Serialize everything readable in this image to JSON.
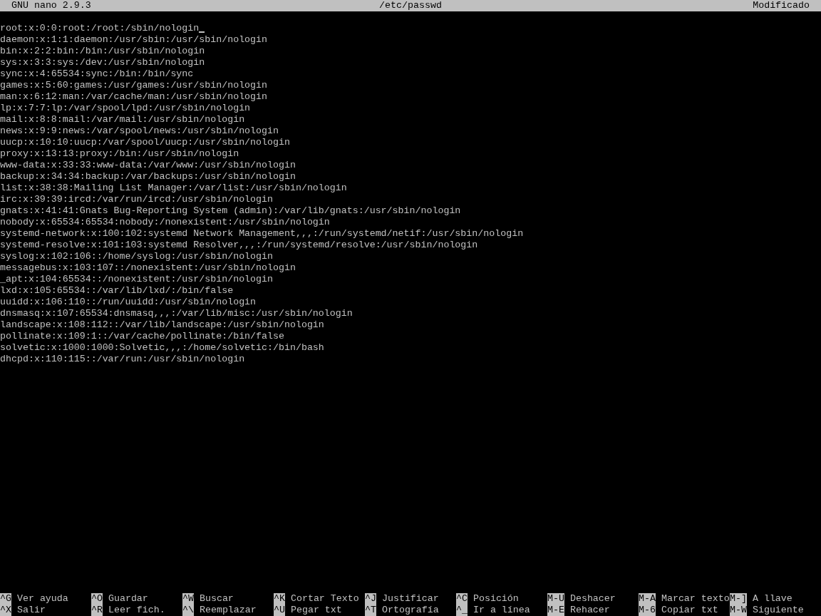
{
  "title_bar": {
    "version": "GNU nano 2.9.3",
    "filename": "/etc/passwd",
    "status": "Modificado"
  },
  "lines": [
    {
      "text": "root:x:0:0:root:/root:/sbin/nologin",
      "cursor": true
    },
    {
      "text": "daemon:x:1:1:daemon:/usr/sbin:/usr/sbin/nologin",
      "cursor": false
    },
    {
      "text": "bin:x:2:2:bin:/bin:/usr/sbin/nologin",
      "cursor": false
    },
    {
      "text": "sys:x:3:3:sys:/dev:/usr/sbin/nologin",
      "cursor": false
    },
    {
      "text": "sync:x:4:65534:sync:/bin:/bin/sync",
      "cursor": false
    },
    {
      "text": "games:x:5:60:games:/usr/games:/usr/sbin/nologin",
      "cursor": false
    },
    {
      "text": "man:x:6:12:man:/var/cache/man:/usr/sbin/nologin",
      "cursor": false
    },
    {
      "text": "lp:x:7:7:lp:/var/spool/lpd:/usr/sbin/nologin",
      "cursor": false
    },
    {
      "text": "mail:x:8:8:mail:/var/mail:/usr/sbin/nologin",
      "cursor": false
    },
    {
      "text": "news:x:9:9:news:/var/spool/news:/usr/sbin/nologin",
      "cursor": false
    },
    {
      "text": "uucp:x:10:10:uucp:/var/spool/uucp:/usr/sbin/nologin",
      "cursor": false
    },
    {
      "text": "proxy:x:13:13:proxy:/bin:/usr/sbin/nologin",
      "cursor": false
    },
    {
      "text": "www-data:x:33:33:www-data:/var/www:/usr/sbin/nologin",
      "cursor": false
    },
    {
      "text": "backup:x:34:34:backup:/var/backups:/usr/sbin/nologin",
      "cursor": false
    },
    {
      "text": "list:x:38:38:Mailing List Manager:/var/list:/usr/sbin/nologin",
      "cursor": false
    },
    {
      "text": "irc:x:39:39:ircd:/var/run/ircd:/usr/sbin/nologin",
      "cursor": false
    },
    {
      "text": "gnats:x:41:41:Gnats Bug-Reporting System (admin):/var/lib/gnats:/usr/sbin/nologin",
      "cursor": false
    },
    {
      "text": "nobody:x:65534:65534:nobody:/nonexistent:/usr/sbin/nologin",
      "cursor": false
    },
    {
      "text": "systemd-network:x:100:102:systemd Network Management,,,:/run/systemd/netif:/usr/sbin/nologin",
      "cursor": false
    },
    {
      "text": "systemd-resolve:x:101:103:systemd Resolver,,,:/run/systemd/resolve:/usr/sbin/nologin",
      "cursor": false
    },
    {
      "text": "syslog:x:102:106::/home/syslog:/usr/sbin/nologin",
      "cursor": false
    },
    {
      "text": "messagebus:x:103:107::/nonexistent:/usr/sbin/nologin",
      "cursor": false
    },
    {
      "text": "_apt:x:104:65534::/nonexistent:/usr/sbin/nologin",
      "cursor": false
    },
    {
      "text": "lxd:x:105:65534::/var/lib/lxd/:/bin/false",
      "cursor": false
    },
    {
      "text": "uuidd:x:106:110::/run/uuidd:/usr/sbin/nologin",
      "cursor": false
    },
    {
      "text": "dnsmasq:x:107:65534:dnsmasq,,,:/var/lib/misc:/usr/sbin/nologin",
      "cursor": false
    },
    {
      "text": "landscape:x:108:112::/var/lib/landscape:/usr/sbin/nologin",
      "cursor": false
    },
    {
      "text": "pollinate:x:109:1::/var/cache/pollinate:/bin/false",
      "cursor": false
    },
    {
      "text": "solvetic:x:1000:1000:Solvetic,,,:/home/solvetic:/bin/bash",
      "cursor": false
    },
    {
      "text": "dhcpd:x:110:115::/var/run:/usr/sbin/nologin",
      "cursor": false
    }
  ],
  "shortcuts": [
    {
      "key": "^G",
      "label": "Ver ayuda"
    },
    {
      "key": "^O",
      "label": "Guardar"
    },
    {
      "key": "^W",
      "label": "Buscar"
    },
    {
      "key": "^K",
      "label": "Cortar Texto"
    },
    {
      "key": "^J",
      "label": "Justificar"
    },
    {
      "key": "^C",
      "label": "Posición"
    },
    {
      "key": "M-U",
      "label": "Deshacer"
    },
    {
      "key": "M-A",
      "label": "Marcar texto"
    },
    {
      "key": "M-]",
      "label": "A llave"
    },
    {
      "key": "^X",
      "label": "Salir"
    },
    {
      "key": "^R",
      "label": "Leer fich."
    },
    {
      "key": "^\\",
      "label": "Reemplazar"
    },
    {
      "key": "^U",
      "label": "Pegar txt"
    },
    {
      "key": "^T",
      "label": "Ortografía"
    },
    {
      "key": "^_",
      "label": "Ir a línea"
    },
    {
      "key": "M-E",
      "label": "Rehacer"
    },
    {
      "key": "M-6",
      "label": "Copiar txt"
    },
    {
      "key": "M-W",
      "label": "Siguiente"
    }
  ]
}
